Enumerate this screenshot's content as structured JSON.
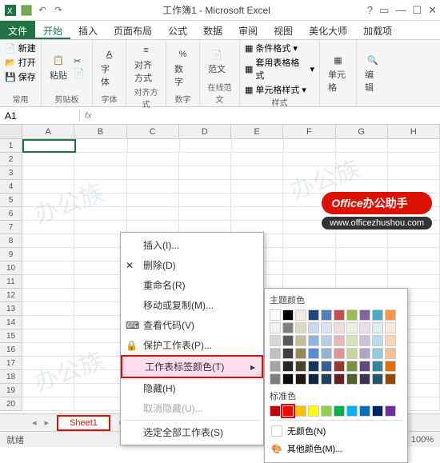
{
  "title": "工作簿1 - Microsoft Excel",
  "tabs": {
    "file": "文件",
    "home": "开始",
    "insert": "插入",
    "layout": "页面布局",
    "formula": "公式",
    "data": "数据",
    "review": "审阅",
    "view": "视图",
    "beauty": "美化大师",
    "addin": "加载项"
  },
  "quick": {
    "new": "新建",
    "open": "打开",
    "save": "保存",
    "common": "常用"
  },
  "ribbon": {
    "clipboard": {
      "paste": "粘贴",
      "label": "剪贴板"
    },
    "font": {
      "btn": "字体",
      "label": "字体"
    },
    "align": {
      "btn": "对齐方式",
      "label": "对齐方式"
    },
    "number": {
      "btn": "数字",
      "label": "数字"
    },
    "range": {
      "btn": "范文",
      "label": "在线范文"
    },
    "styles": {
      "cond": "条件格式",
      "table": "套用表格格式",
      "cell": "单元格样式",
      "label": "样式"
    },
    "cells": {
      "btn": "单元格"
    },
    "edit": {
      "btn": "编辑"
    }
  },
  "namebox": "A1",
  "cols": [
    "A",
    "B",
    "C",
    "D",
    "E",
    "F",
    "G",
    "H"
  ],
  "rownums": [
    "1",
    "2",
    "3",
    "4",
    "5",
    "6",
    "7",
    "8",
    "9",
    "10",
    "11",
    "12",
    "13",
    "14",
    "15",
    "16",
    "17",
    "18",
    "19",
    "20"
  ],
  "sheettab": "Sheet1",
  "ctx": {
    "insert": "插入(I)...",
    "delete": "删除(D)",
    "rename": "重命名(R)",
    "move": "移动或复制(M)...",
    "viewcode": "查看代码(V)",
    "protect": "保护工作表(P)...",
    "tabcolor": "工作表标签颜色(T)",
    "hide": "隐藏(H)",
    "unhide": "取消隐藏(U)...",
    "selectall": "选定全部工作表(S)"
  },
  "colorpop": {
    "theme": "主题颜色",
    "standard": "标准色",
    "nocolor": "无颜色(N)",
    "more": "其他颜色(M)..."
  },
  "chart_data": {
    "theme_colors": [
      [
        "#ffffff",
        "#000000",
        "#eeece1",
        "#1f497d",
        "#4f81bd",
        "#c0504d",
        "#9bbb59",
        "#8064a2",
        "#4bacc6",
        "#f79646"
      ],
      [
        "#f2f2f2",
        "#7f7f7f",
        "#ddd9c3",
        "#c6d9f0",
        "#dbe5f1",
        "#f2dcdb",
        "#ebf1dd",
        "#e5e0ec",
        "#dbeef3",
        "#fdeada"
      ],
      [
        "#d8d8d8",
        "#595959",
        "#c4bd97",
        "#8db3e2",
        "#b8cce4",
        "#e5b9b7",
        "#d7e3bc",
        "#ccc1d9",
        "#b7dde8",
        "#fbd5b5"
      ],
      [
        "#bfbfbf",
        "#3f3f3f",
        "#938953",
        "#548dd4",
        "#95b3d7",
        "#d99694",
        "#c3d69b",
        "#b2a2c7",
        "#92cddc",
        "#fac08f"
      ],
      [
        "#a5a5a5",
        "#262626",
        "#494429",
        "#17365d",
        "#366092",
        "#953734",
        "#76923c",
        "#5f497a",
        "#31859b",
        "#e36c09"
      ],
      [
        "#7f7f7f",
        "#0c0c0c",
        "#1d1b10",
        "#0f243e",
        "#244061",
        "#632423",
        "#4f6128",
        "#3f3151",
        "#205867",
        "#974806"
      ]
    ],
    "standard_colors": [
      "#c00000",
      "#ff0000",
      "#ffc000",
      "#ffff00",
      "#92d050",
      "#00b050",
      "#00b0f0",
      "#0070c0",
      "#002060",
      "#7030a0"
    ],
    "selected_standard_index": 1
  },
  "status": {
    "ready": "就绪",
    "zoom": "100%"
  },
  "badge": {
    "t1a": "Office",
    "t1b": "办公助手",
    "url": "www.officezhushou.com"
  },
  "wm": "办公族"
}
